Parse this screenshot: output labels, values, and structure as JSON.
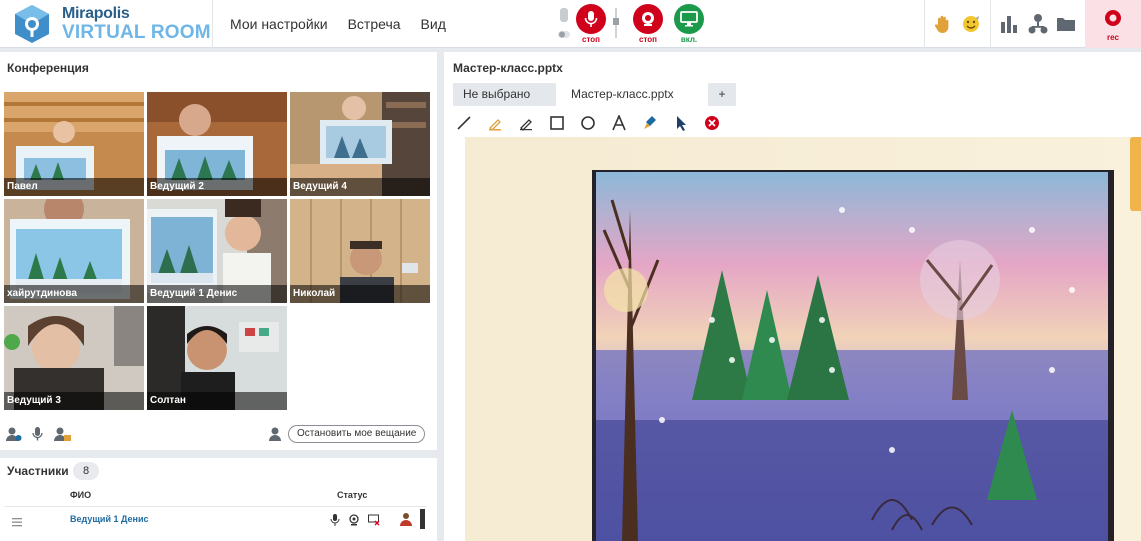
{
  "logo": {
    "line1": "Mirapolis",
    "line2": "VIRTUAL ROOM"
  },
  "menu": [
    "Мои настройки",
    "Встреча",
    "Вид"
  ],
  "controls": {
    "mic_label": "стоп",
    "cam_label": "стоп",
    "screen_label": "вкл.",
    "rec_label": "rec"
  },
  "colors": {
    "accent": "#d0021b",
    "green": "#1a9a4a",
    "link": "#1e6ba0"
  },
  "conference": {
    "title": "Конференция",
    "tiles": [
      "Павел",
      "Ведущий 2",
      "Ведущий 4",
      "хайрутдинова",
      "Ведущий 1 Денис",
      "Николай",
      "Ведущий 3",
      "Солтан"
    ],
    "stop_button": "Остановить мое вещание"
  },
  "participants": {
    "title": "Участники",
    "count": "8",
    "col_name": "ФИО",
    "col_status": "Статус",
    "rows": [
      {
        "name": "Ведущий 1 Денис"
      }
    ]
  },
  "document": {
    "title": "Мастер-класс.pptx",
    "tabs": [
      "Не выбрано",
      "Мастер-класс.pptx",
      "+"
    ],
    "tools": [
      "line-tool-icon",
      "highlighter-icon",
      "pen-icon",
      "rectangle-icon",
      "circle-icon",
      "text-icon",
      "fill-icon",
      "pointer-icon",
      "clear-icon"
    ]
  }
}
